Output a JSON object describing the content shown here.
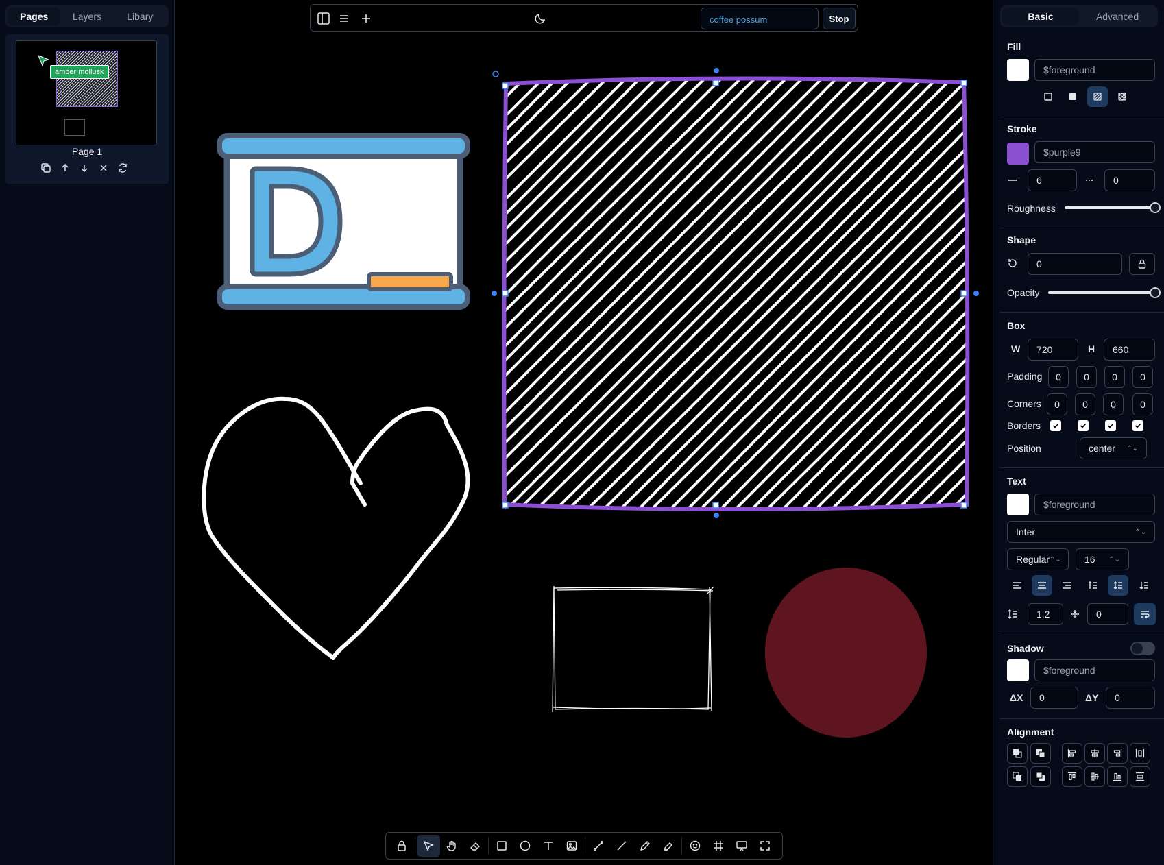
{
  "left_panel": {
    "tabs": [
      "Pages",
      "Layers",
      "Libary"
    ],
    "active_tab": "Pages",
    "page": {
      "label": "Page 1",
      "collaborator_tag": "amber mollusk"
    },
    "page_actions": [
      "duplicate-icon",
      "move-up-icon",
      "move-down-icon",
      "delete-icon",
      "refresh-icon"
    ]
  },
  "topbar": {
    "icons": [
      "sidebar-icon",
      "menu-icon",
      "plus-icon",
      "moon-icon"
    ],
    "room_value": "coffee possum",
    "stop_label": "Stop"
  },
  "canvas": {
    "shapes": [
      "whiteboard-illustration",
      "heart-drawing",
      "hatched-rectangle",
      "sketch-rectangle",
      "dark-red-circle"
    ],
    "selection_color": "#8b5cf6",
    "circle_color": "#5f1520"
  },
  "bottom_toolbar": {
    "tools": [
      "lock",
      "select",
      "hand",
      "eraser",
      "rectangle",
      "ellipse",
      "text",
      "image",
      "arrow",
      "line",
      "pencil",
      "highlighter",
      "emoji",
      "frame",
      "presentation",
      "fullscreen"
    ],
    "active_tool": "select"
  },
  "right_panel": {
    "tabs": [
      "Basic",
      "Advanced"
    ],
    "active_tab": "Basic",
    "fill": {
      "title": "Fill",
      "color": "#ffffff",
      "value": "$foreground",
      "styles": [
        "none",
        "solid",
        "hachure",
        "cross-hatch"
      ],
      "active_style": "hachure"
    },
    "stroke": {
      "title": "Stroke",
      "color": "#8b4fd1",
      "value": "$purple9",
      "width": "6",
      "dash": "0"
    },
    "roughness": {
      "label": "Roughness",
      "value": 1.0
    },
    "shape": {
      "title": "Shape",
      "rotation": "0"
    },
    "opacity": {
      "label": "Opacity",
      "value": 1.0
    },
    "box": {
      "title": "Box",
      "w_label": "W",
      "w": "720",
      "h_label": "H",
      "h": "660",
      "padding_label": "Padding",
      "padding": [
        "0",
        "0",
        "0",
        "0"
      ],
      "corners_label": "Corners",
      "corners": [
        "0",
        "0",
        "0",
        "0"
      ],
      "borders_label": "Borders",
      "position_label": "Position",
      "position": "center"
    },
    "text": {
      "title": "Text",
      "color": "#ffffff",
      "value": "$foreground",
      "font": "Inter",
      "weight": "Regular",
      "size": "16",
      "line_height": "1.2",
      "spacing": "0"
    },
    "shadow": {
      "title": "Shadow",
      "color": "#ffffff",
      "value": "$foreground",
      "dx_label": "ΔX",
      "dx": "0",
      "dy_label": "ΔY",
      "dy": "0"
    },
    "alignment": {
      "title": "Alignment"
    }
  }
}
